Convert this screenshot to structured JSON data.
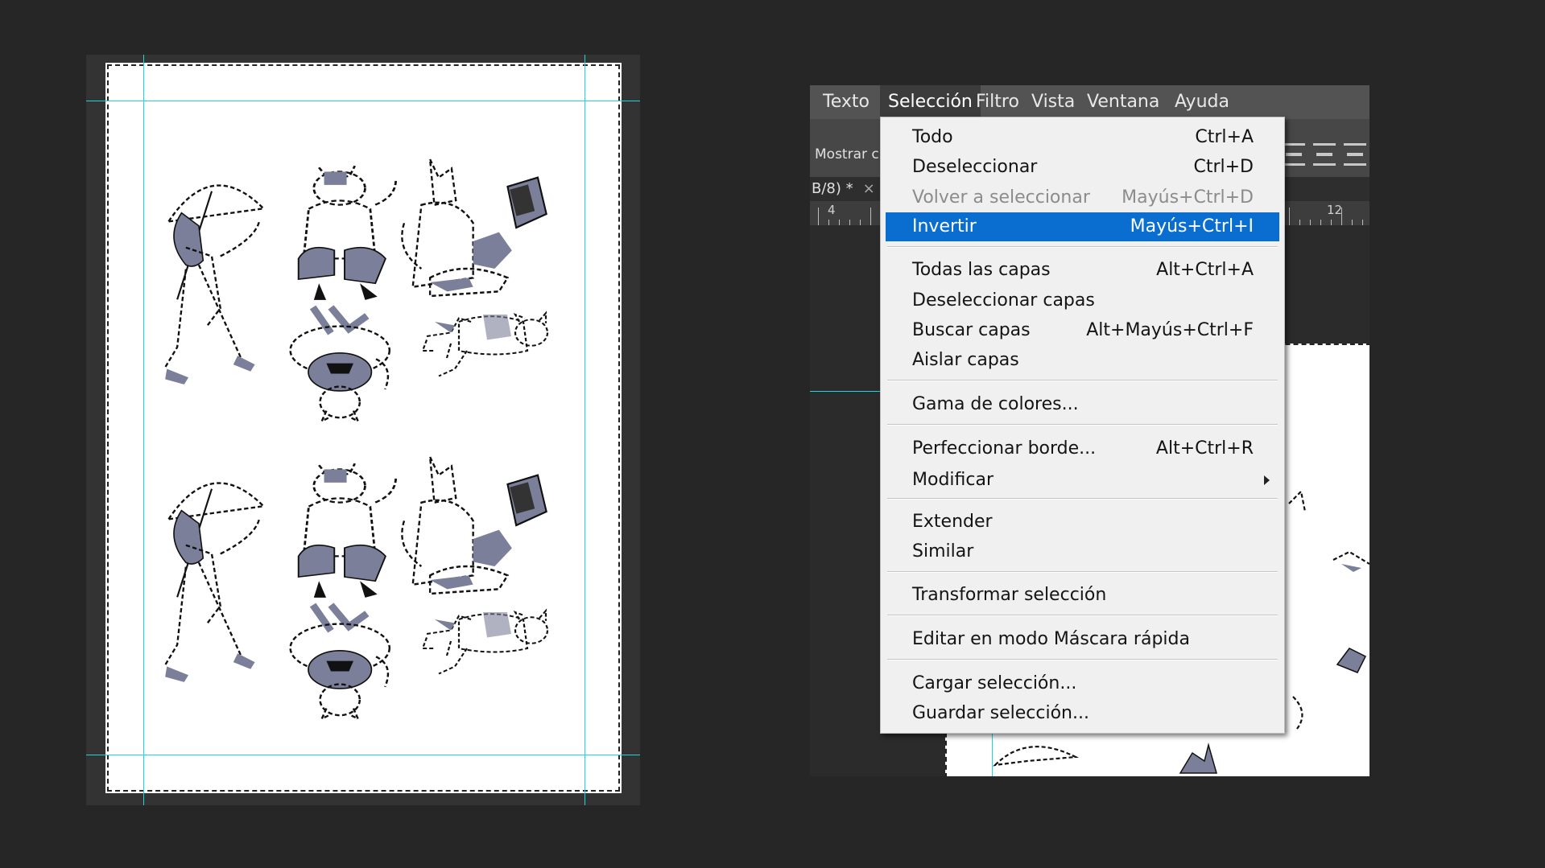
{
  "menubar": {
    "items": [
      "Texto",
      "Selección",
      "Filtro",
      "Vista",
      "Ventana",
      "Ayuda"
    ],
    "active": "Selección"
  },
  "options_bar": {
    "label": "Mostrar c"
  },
  "document_tab": {
    "title": "B/8) *",
    "close": "×"
  },
  "ruler": {
    "labels": [
      "4",
      "12"
    ]
  },
  "dropdown": {
    "groups": [
      [
        {
          "label": "Todo",
          "shortcut": "Ctrl+A",
          "enabled": true
        },
        {
          "label": "Deseleccionar",
          "shortcut": "Ctrl+D",
          "enabled": true
        },
        {
          "label": "Volver a seleccionar",
          "shortcut": "Mayús+Ctrl+D",
          "enabled": false
        },
        {
          "label": "Invertir",
          "shortcut": "Mayús+Ctrl+I",
          "enabled": true,
          "highlighted": true
        }
      ],
      [
        {
          "label": "Todas las capas",
          "shortcut": "Alt+Ctrl+A",
          "enabled": true
        },
        {
          "label": "Deseleccionar capas",
          "shortcut": "",
          "enabled": true
        },
        {
          "label": "Buscar capas",
          "shortcut": "Alt+Mayús+Ctrl+F",
          "enabled": true
        },
        {
          "label": "Aislar capas",
          "shortcut": "",
          "enabled": true
        }
      ],
      [
        {
          "label": "Gama de colores...",
          "shortcut": "",
          "enabled": true
        }
      ],
      [
        {
          "label": "Perfeccionar borde...",
          "shortcut": "Alt+Ctrl+R",
          "enabled": true
        },
        {
          "label": "Modificar",
          "shortcut": "",
          "enabled": true,
          "submenu": true
        }
      ],
      [
        {
          "label": "Extender",
          "shortcut": "",
          "enabled": true
        },
        {
          "label": "Similar",
          "shortcut": "",
          "enabled": true
        }
      ],
      [
        {
          "label": "Transformar selección",
          "shortcut": "",
          "enabled": true
        }
      ],
      [
        {
          "label": "Editar en modo Máscara rápida",
          "shortcut": "",
          "enabled": true
        }
      ],
      [
        {
          "label": "Cargar selección...",
          "shortcut": "",
          "enabled": true
        },
        {
          "label": "Guardar selección...",
          "shortcut": "",
          "enabled": true
        }
      ]
    ]
  },
  "colors": {
    "highlight": "#0a6ed1",
    "guide": "#1fd6e0",
    "figure_fill": "#7b7f99",
    "background": "#262626"
  }
}
